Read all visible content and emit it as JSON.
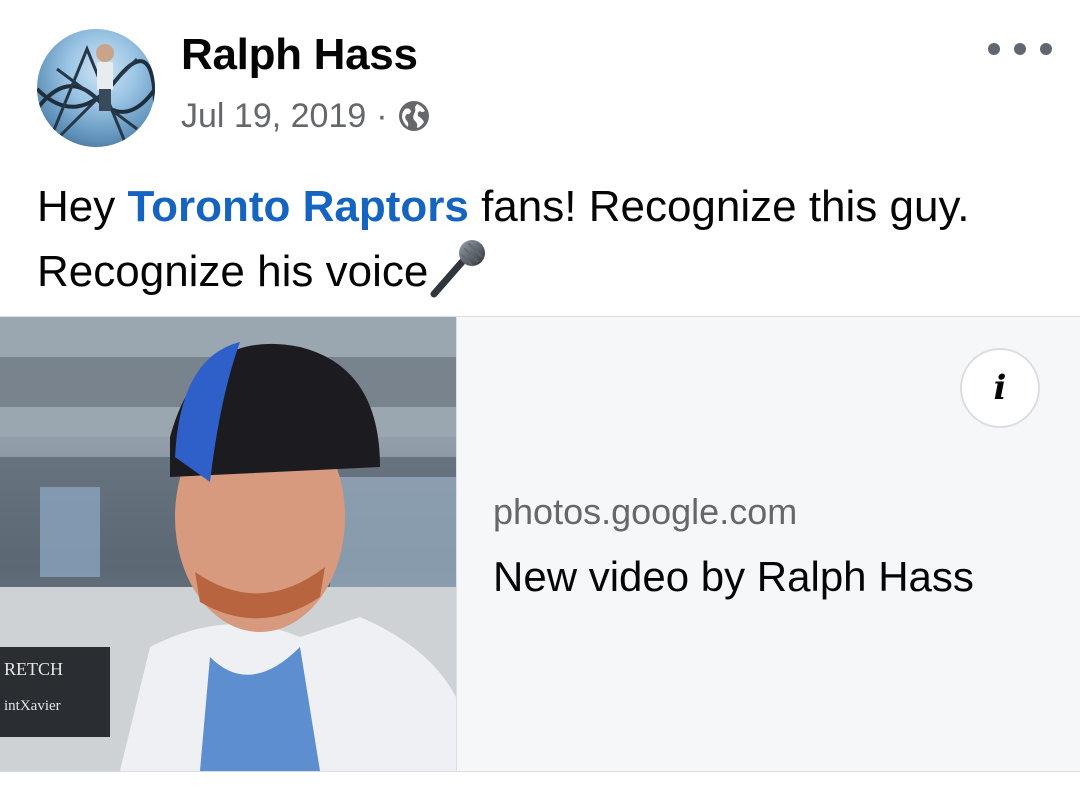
{
  "post": {
    "author": "Ralph Hass",
    "date": "Jul 19, 2019",
    "separator": "·",
    "audience_icon": "globe-icon",
    "more_icon": "more-options-icon",
    "text": {
      "prefix": "Hey ",
      "mention": "Toronto Raptors",
      "suffix": " fans! Recognize this guy. Recognize his voice",
      "emoji": "microphone-icon"
    }
  },
  "link_preview": {
    "domain": "photos.google.com",
    "title": "New video by Ralph Hass",
    "info_label": "i",
    "info_icon": "info-icon",
    "thumbnail_overlay_lines": [
      "RETCH",
      "intXavier"
    ]
  },
  "colors": {
    "mention": "#1565c0",
    "secondary_text": "#65676b",
    "card_background": "#f6f7f9"
  }
}
